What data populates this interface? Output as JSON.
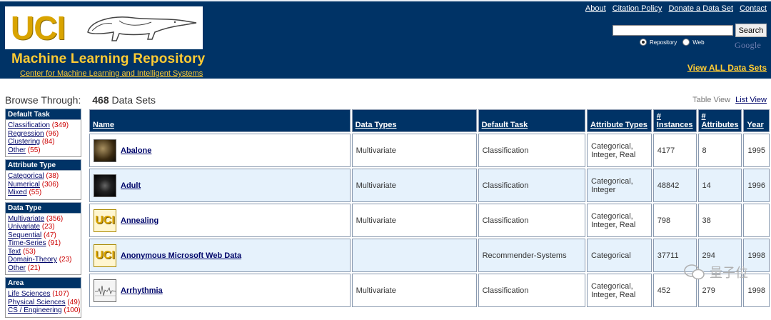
{
  "header": {
    "logo_text": "UCI",
    "title": "Machine Learning Repository",
    "subtitle": "Center for Machine Learning and Intelligent Systems",
    "links": [
      "About",
      "Citation Policy",
      "Donate a Data Set",
      "Contact"
    ],
    "search_value": "",
    "search_button": "Search",
    "radio_options": [
      {
        "label": "Repository",
        "selected": true
      },
      {
        "label": "Web",
        "selected": false
      }
    ],
    "google_label": "Google",
    "view_all": "View ALL Data Sets",
    "brand_color": "#003366",
    "accent_color": "#ffcc33"
  },
  "browse": {
    "label": "Browse Through:",
    "count": "468",
    "count_suffix": "Data Sets",
    "table_view": "Table View",
    "list_view": "List View"
  },
  "sidebar": [
    {
      "title": "Default Task",
      "items": [
        {
          "label": "Classification",
          "count": "(349)"
        },
        {
          "label": "Regression",
          "count": "(96)"
        },
        {
          "label": "Clustering",
          "count": "(84)"
        },
        {
          "label": "Other",
          "count": "(55)"
        }
      ]
    },
    {
      "title": "Attribute Type",
      "items": [
        {
          "label": "Categorical",
          "count": "(38)"
        },
        {
          "label": "Numerical",
          "count": "(306)"
        },
        {
          "label": "Mixed",
          "count": "(55)"
        }
      ]
    },
    {
      "title": "Data Type",
      "items": [
        {
          "label": "Multivariate",
          "count": "(356)"
        },
        {
          "label": "Univariate",
          "count": "(23)"
        },
        {
          "label": "Sequential",
          "count": "(47)"
        },
        {
          "label": "Time-Series",
          "count": "(91)"
        },
        {
          "label": "Text",
          "count": "(53)"
        },
        {
          "label": "Domain-Theory",
          "count": "(23)"
        },
        {
          "label": "Other",
          "count": "(21)"
        }
      ]
    },
    {
      "title": "Area",
      "items": [
        {
          "label": "Life Sciences",
          "count": "(107)"
        },
        {
          "label": "Physical Sciences",
          "count": "(49)"
        },
        {
          "label": "CS / Engineering",
          "count": "(100)"
        }
      ]
    }
  ],
  "table": {
    "headers": [
      "Name",
      "Data Types",
      "Default Task",
      "Attribute Types",
      "# Instances",
      "# Attributes",
      "Year"
    ],
    "rows": [
      {
        "thumb": "dark",
        "name": "Abalone",
        "data_types": "Multivariate",
        "task": "Classification",
        "attr_types": "Categorical, Integer, Real",
        "instances": "4177",
        "attributes": "8",
        "year": "1995"
      },
      {
        "thumb": "night",
        "name": "Adult",
        "data_types": "Multivariate",
        "task": "Classification",
        "attr_types": "Categorical, Integer",
        "instances": "48842",
        "attributes": "14",
        "year": "1996"
      },
      {
        "thumb": "uci",
        "name": "Annealing",
        "data_types": "Multivariate",
        "task": "Classification",
        "attr_types": "Categorical, Integer, Real",
        "instances": "798",
        "attributes": "38",
        "year": ""
      },
      {
        "thumb": "uci",
        "name": "Anonymous Microsoft Web Data",
        "data_types": "",
        "task": "Recommender-Systems",
        "attr_types": "Categorical",
        "instances": "37711",
        "attributes": "294",
        "year": "1998"
      },
      {
        "thumb": "ecg",
        "name": "Arrhythmia",
        "data_types": "Multivariate",
        "task": "Classification",
        "attr_types": "Categorical, Integer, Real",
        "instances": "452",
        "attributes": "279",
        "year": "1998"
      }
    ]
  },
  "watermark": "量子位"
}
